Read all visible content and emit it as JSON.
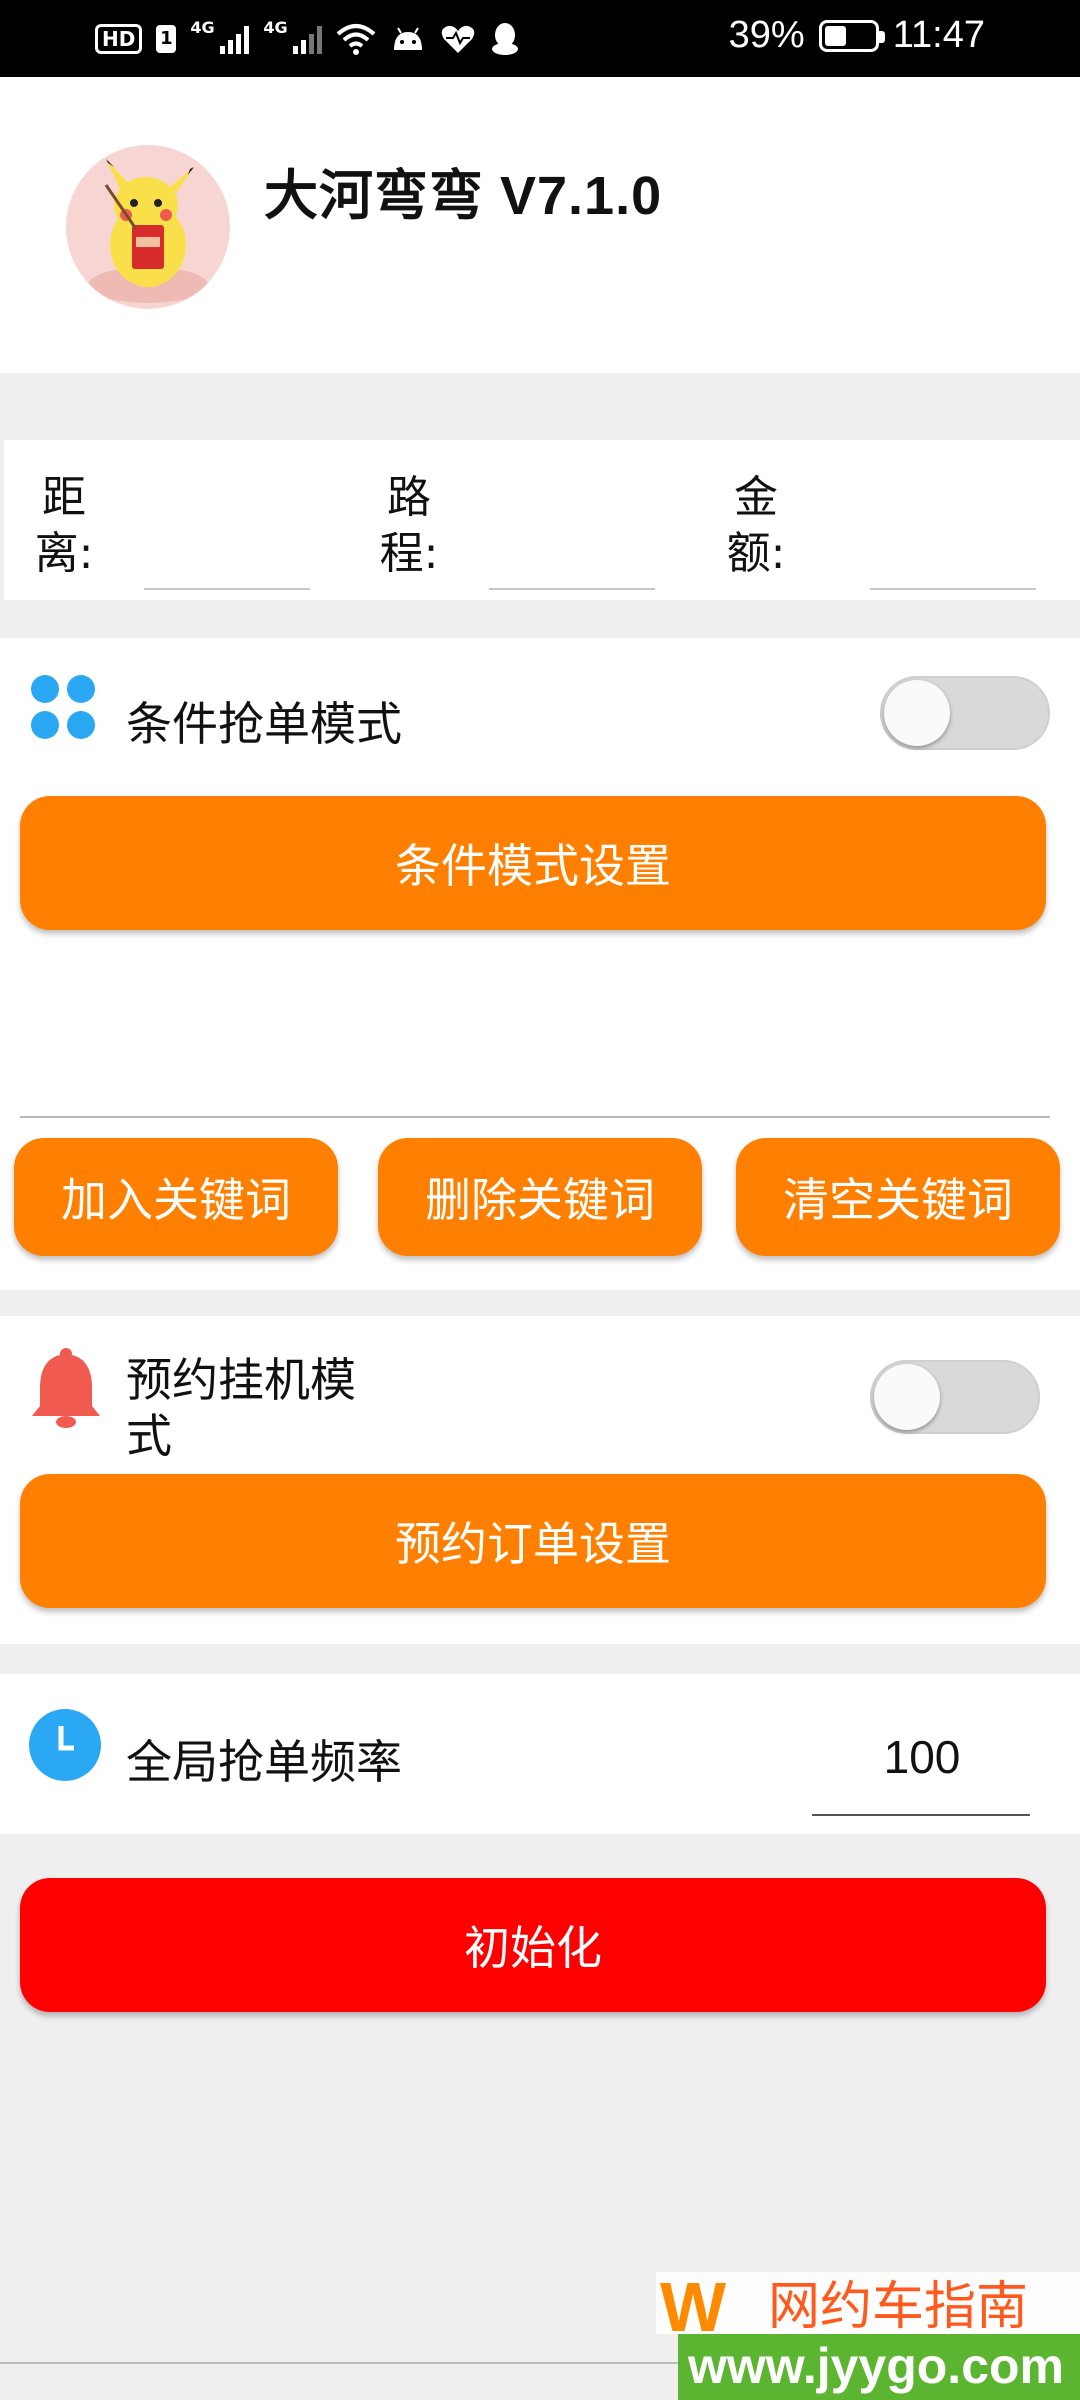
{
  "status_bar": {
    "hd": "HD",
    "sim": "1",
    "net1": "4G",
    "net2": "4G",
    "battery": "39%",
    "time": "11:47"
  },
  "header": {
    "title": "大河弯弯 V7.1.0"
  },
  "stats": {
    "distance_label": "距离:",
    "route_label": "路程:",
    "amount_label": "金额:",
    "distance_value": "",
    "route_value": "",
    "amount_value": ""
  },
  "condition_mode": {
    "label": "条件抢单模式",
    "enabled": false,
    "settings_button": "条件模式设置",
    "keyword_input": "",
    "add_button": "加入关键词",
    "delete_button": "删除关键词",
    "clear_button": "清空关键词"
  },
  "reserve_mode": {
    "label_line1": "预约挂机模",
    "label_line2": "式",
    "enabled": false,
    "settings_button": "预约订单设置"
  },
  "frequency": {
    "label": "全局抢单频率",
    "value": "100"
  },
  "init_button": "初始化",
  "watermark": {
    "logo_letter": "W",
    "name": "网约车指南",
    "url": "www.jyygo.com"
  },
  "colors": {
    "orange": "#ff8000",
    "red": "#ff0000",
    "blue_icon": "#2ba8f4",
    "bell": "#f05a4f"
  }
}
